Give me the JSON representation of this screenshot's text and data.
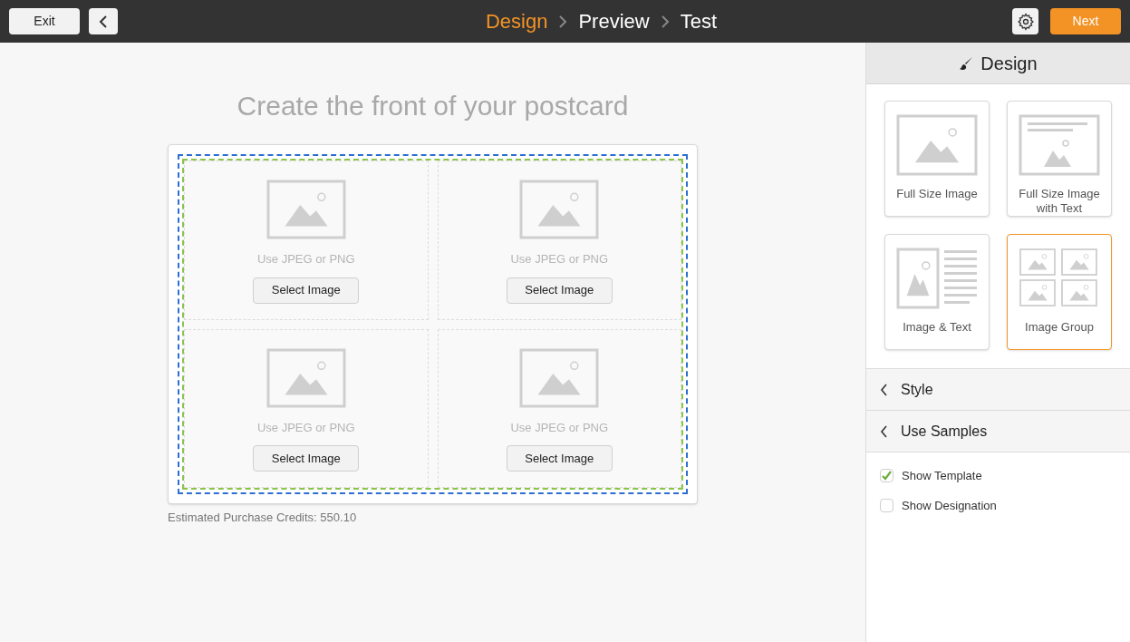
{
  "toolbar": {
    "exit": "Exit",
    "steps": [
      {
        "label": "Design",
        "selected": true
      },
      {
        "label": "Preview",
        "selected": false
      },
      {
        "label": "Test",
        "selected": false
      }
    ],
    "next": "Next"
  },
  "canvas": {
    "heading": "Create the front of your postcard",
    "slots": [
      {
        "hint": "Use JPEG or PNG",
        "button": "Select Image"
      },
      {
        "hint": "Use JPEG or PNG",
        "button": "Select Image"
      },
      {
        "hint": "Use JPEG or PNG",
        "button": "Select Image"
      },
      {
        "hint": "Use JPEG or PNG",
        "button": "Select Image"
      }
    ],
    "credits": "Estimated Purchase Credits: 550.10"
  },
  "panel": {
    "title": "Design",
    "layouts": [
      {
        "kind": "full",
        "label": "Full Size Image",
        "selected": false
      },
      {
        "kind": "fulltext",
        "label": "Full Size Image with Text",
        "selected": false
      },
      {
        "kind": "imagetext",
        "label": "Image & Text",
        "selected": false
      },
      {
        "kind": "group",
        "label": "Image Group",
        "selected": true
      }
    ],
    "sections": [
      {
        "label": "Style",
        "expanded": false
      },
      {
        "label": "Use Samples",
        "expanded": false
      }
    ],
    "options": [
      {
        "label": "Show Template",
        "checked": true
      },
      {
        "label": "Show Designation",
        "checked": false
      }
    ]
  }
}
